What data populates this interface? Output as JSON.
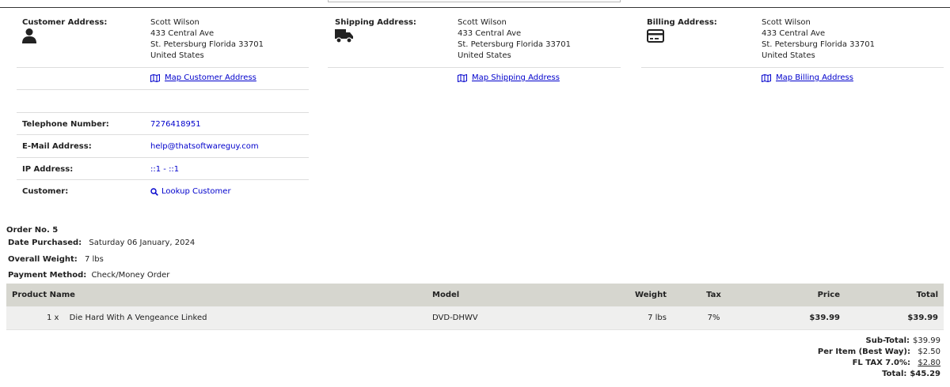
{
  "customer_address": {
    "label": "Customer Address:",
    "name": "Scott Wilson",
    "street": "433 Central Ave",
    "city": "St. Petersburg Florida 33701",
    "country": "United States",
    "map_link": "Map Customer Address"
  },
  "shipping_address": {
    "label": "Shipping Address:",
    "name": "Scott Wilson",
    "street": "433 Central Ave",
    "city": "St. Petersburg Florida 33701",
    "country": "United States",
    "map_link": "Map Shipping Address"
  },
  "billing_address": {
    "label": "Billing Address:",
    "name": "Scott Wilson",
    "street": "433 Central Ave",
    "city": "St. Petersburg Florida 33701",
    "country": "United States",
    "map_link": "Map Billing Address"
  },
  "contact": {
    "telephone_label": "Telephone Number:",
    "telephone_value": "7276418951",
    "email_label": "E-Mail Address:",
    "email_value": "help@thatsoftwareguy.com",
    "ip_label": "IP Address:",
    "ip_value": "::1 - ::1",
    "customer_label": "Customer:",
    "customer_link": "Lookup Customer"
  },
  "order": {
    "number": "Order No. 5",
    "date_label": "Date Purchased:",
    "date_value": "Saturday 06 January, 2024",
    "weight_label": "Overall Weight:",
    "weight_value": "7 lbs",
    "payment_label": "Payment Method:",
    "payment_value": "Check/Money Order"
  },
  "products": {
    "headers": {
      "name": "Product Name",
      "model": "Model",
      "weight": "Weight",
      "tax": "Tax",
      "price": "Price",
      "total": "Total"
    },
    "rows": [
      {
        "qty": "1 x",
        "name": "Die Hard With A Vengeance Linked",
        "model": "DVD-DHWV",
        "weight": "7 lbs",
        "tax": "7%",
        "price": "$39.99",
        "total": "$39.99"
      }
    ]
  },
  "totals": {
    "subtotal_label": "Sub-Total:",
    "subtotal_value": "$39.99",
    "shipping_label": "Per Item (Best Way):",
    "shipping_value": "$2.50",
    "tax_label": "FL TAX 7.0%:",
    "tax_value": "$2.80",
    "total_label": "Total:",
    "total_value": "$45.29"
  },
  "icons": {
    "customer": "person-icon",
    "shipping": "truck-icon",
    "billing": "credit-card-icon",
    "map": "map-icon",
    "lookup": "search-icon"
  },
  "colors": {
    "link": "#0000cc",
    "header_bg": "#d6d6cf",
    "row_bg": "#efefee"
  }
}
